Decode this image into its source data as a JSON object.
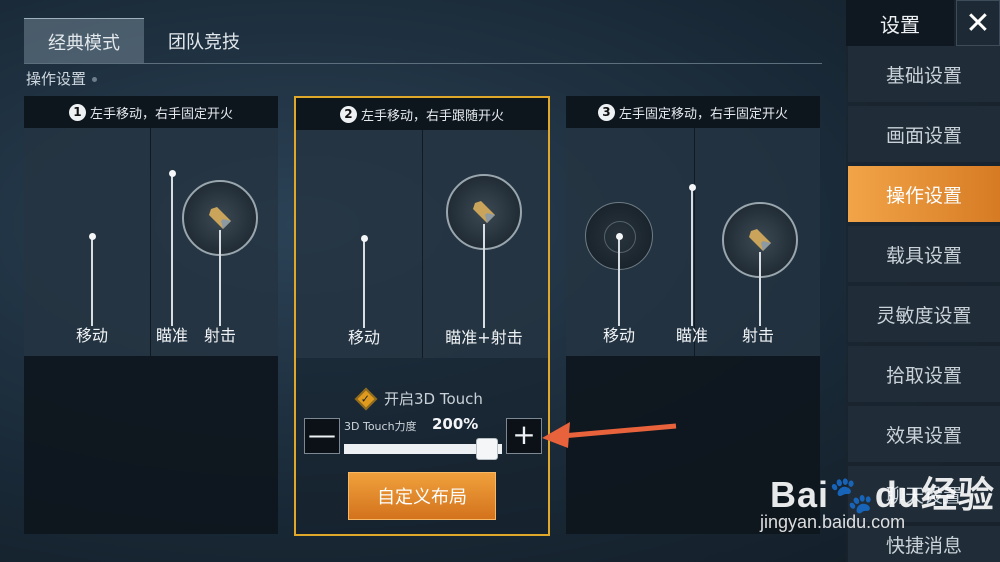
{
  "tabs": {
    "classic": "经典模式",
    "team": "团队竞技"
  },
  "section_title": "操作设置",
  "panels": [
    {
      "number": "1",
      "title": "左手移动，右手固定开火",
      "labels": {
        "move": "移动",
        "aim": "瞄准",
        "shoot": "射击"
      }
    },
    {
      "number": "2",
      "title": "左手移动，右手跟随开火",
      "labels": {
        "move": "移动",
        "aim_shoot": "瞄准+射击"
      }
    },
    {
      "number": "3",
      "title": "左手固定移动，右手固定开火",
      "labels": {
        "move": "移动",
        "aim": "瞄准",
        "shoot": "射击"
      }
    }
  ],
  "touch": {
    "toggle_label": "开启3D Touch",
    "checked": true,
    "force_label": "3D Touch力度",
    "force_value": "200%",
    "minus": "—",
    "plus": "+"
  },
  "custom_layout_label": "自定义布局",
  "sidebar": {
    "title": "设置",
    "close": "✕",
    "items": [
      "基础设置",
      "画面设置",
      "操作设置",
      "载具设置",
      "灵敏度设置",
      "拾取设置",
      "效果设置",
      "聊天设置",
      "快捷消息"
    ],
    "active_index": 2
  },
  "watermark": {
    "main": "Bai🐾du经验",
    "sub": "jingyan.baidu.com"
  },
  "colors": {
    "accent": "#e0a82a",
    "orange": "#e48a2e",
    "arrow": "#e8623c"
  }
}
